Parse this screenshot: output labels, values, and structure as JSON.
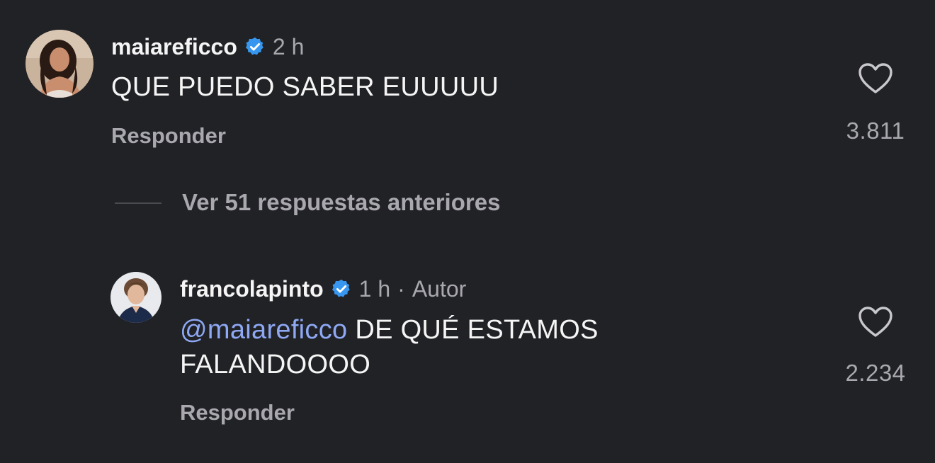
{
  "comments": [
    {
      "username": "maiareficco",
      "time": "2 h",
      "author_tag": "",
      "text": "QUE PUEDO SABER EUUUUU",
      "reply_label": "Responder",
      "likes": "3.811"
    },
    {
      "username": "francolapinto",
      "time": "1 h",
      "author_tag": "Autor",
      "mention": "@maiareficco",
      "text_line1": " DE QUÉ ESTAMOS",
      "text_line2": "FALANDOOOO",
      "reply_label": "Responder",
      "likes": "2.234"
    }
  ],
  "view_more_label": "Ver 51 respuestas anteriores",
  "colors": {
    "background": "#212226",
    "text": "#f5f5f5",
    "muted": "#a8a8ae",
    "mention": "#8ea8f4",
    "verified": "#3797f0"
  }
}
